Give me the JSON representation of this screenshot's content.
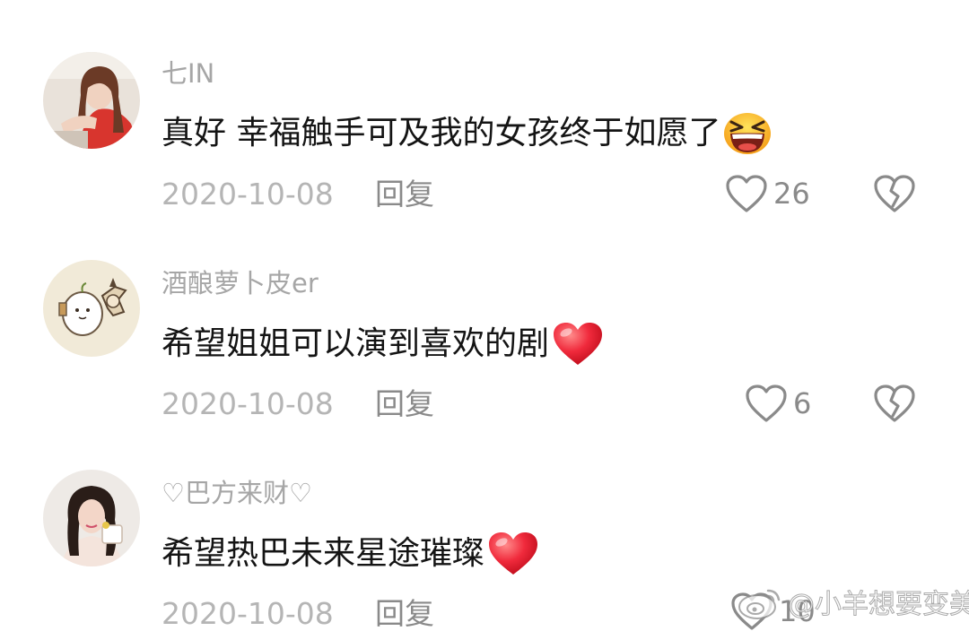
{
  "comments": [
    {
      "username": "七IN",
      "text": "真好 幸福触手可及我的女孩终于如愿了",
      "emoji": "grinning-squinting-face-icon",
      "date": "2020-10-08",
      "reply_label": "回复",
      "likes": "26"
    },
    {
      "username": "酒酿萝卜皮er",
      "text": "希望姐姐可以演到喜欢的剧",
      "emoji": "red-heart-icon",
      "date": "2020-10-08",
      "reply_label": "回复",
      "likes": "6"
    },
    {
      "username": "♡巴方来财♡",
      "text": "希望热巴未来星途璀璨",
      "emoji": "red-heart-icon",
      "date": "2020-10-08",
      "reply_label": "回复",
      "likes": "10"
    }
  ],
  "watermark": {
    "text": "@小羊想要变美",
    "icon": "weibo-logo-icon"
  },
  "colors": {
    "username": "#a6a6a6",
    "text": "#141414",
    "date": "#b5b5b5",
    "action": "#8a8a8a",
    "heart": "#f02a3c"
  }
}
